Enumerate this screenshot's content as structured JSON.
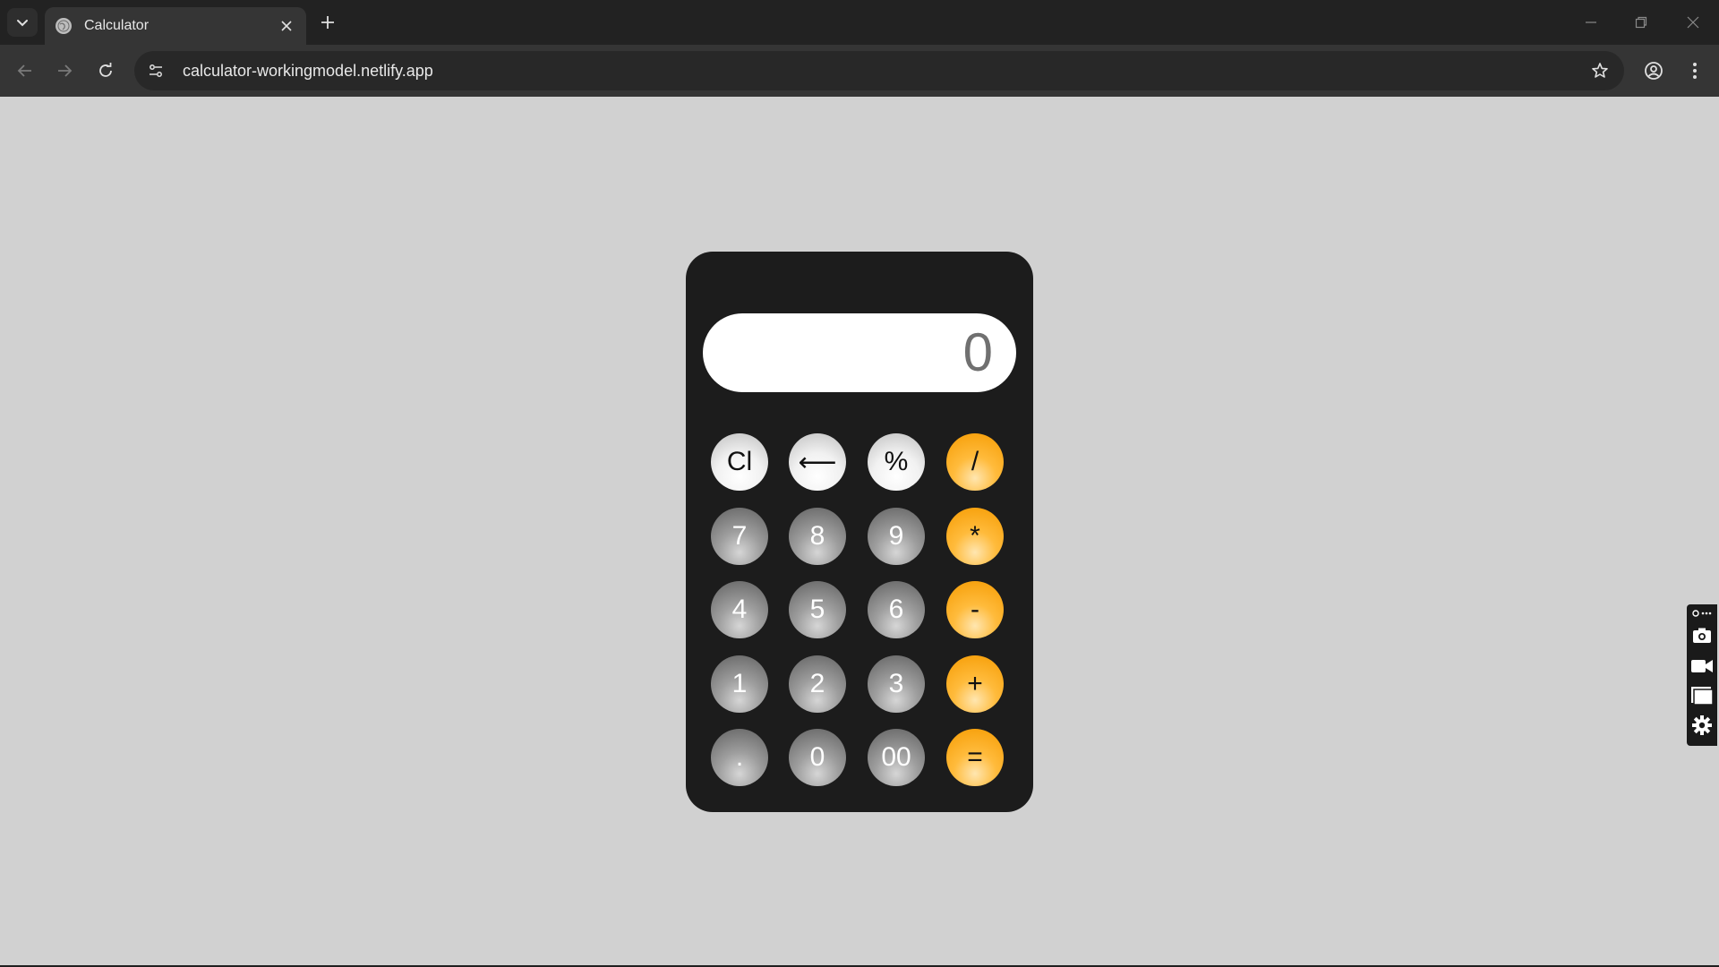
{
  "browser": {
    "tab": {
      "title": "Calculator",
      "favicon": "globe-icon"
    },
    "address_bar": {
      "url": "calculator-workingmodel.netlify.app"
    },
    "icons": {
      "tab_search": "chevron-down-icon",
      "tab_close": "close-icon",
      "new_tab": "plus-icon",
      "back": "arrow-left-icon",
      "forward": "arrow-right-icon",
      "reload": "reload-icon",
      "site_info": "tune-icon",
      "bookmark": "star-icon",
      "profile": "account-icon",
      "menu": "kebab-menu-icon",
      "minimize": "minimize-icon",
      "restore": "restore-icon",
      "close_window": "close-icon"
    }
  },
  "calculator": {
    "display_value": "0",
    "keys": [
      [
        "Cl",
        "⟵",
        "%",
        "/"
      ],
      [
        "7",
        "8",
        "9",
        "*"
      ],
      [
        "4",
        "5",
        "6",
        "-"
      ],
      [
        "1",
        "2",
        "3",
        "+"
      ],
      [
        ".",
        "0",
        "00",
        "="
      ]
    ],
    "colors": {
      "body": "#1c1c1c",
      "page_background": "#d1d1d1",
      "operator_key": "#ffad1f",
      "number_key": "#8a8a8a",
      "function_key": "#f0f0f0"
    }
  },
  "side_panel": {
    "icons": [
      "link-more-icon",
      "camera-icon",
      "video-camera-icon",
      "window-icon",
      "settings-gear-icon"
    ]
  }
}
